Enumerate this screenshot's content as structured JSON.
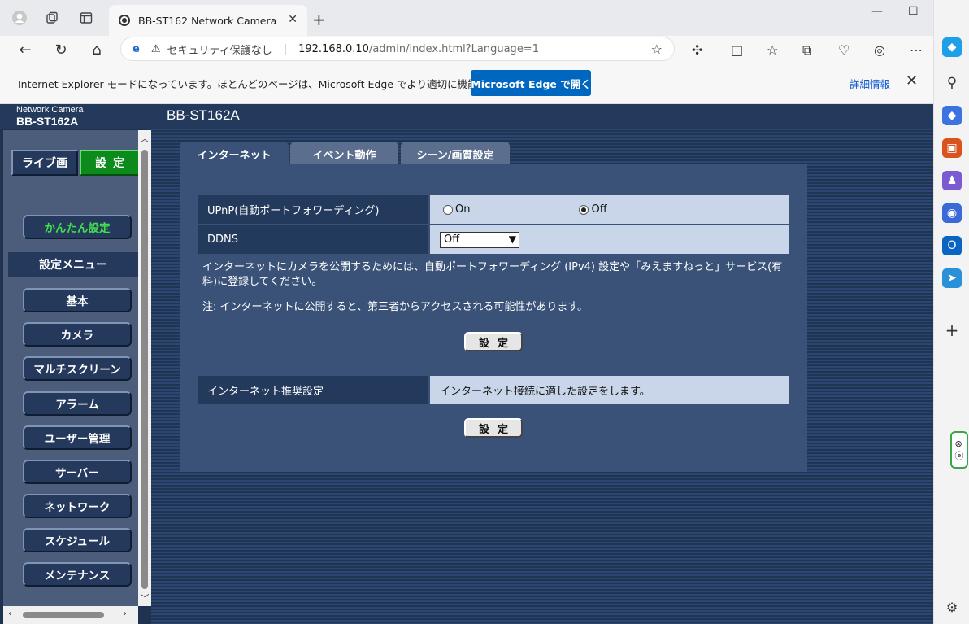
{
  "browser": {
    "tab_title": "BB-ST162 Network Camera",
    "url_security": "セキュリティ保護なし",
    "url_host": "192.168.0.10",
    "url_path": "/admin/index.html?Language=1",
    "new_tab": "+",
    "ie_mode_message": "Internet Explorer モードになっています。ほとんどのページは、Microsoft Edge でより適切に機能します。",
    "open_in_edge_button": "Microsoft Edge で開く",
    "details_link": "詳細情報"
  },
  "camera": {
    "brand_line1": "Network Camera",
    "brand_line2": "BB-ST162A",
    "model_title": "BB-ST162A",
    "mode_live": "ライブ画",
    "mode_setup": "設定",
    "easy_setup": "かんたん設定",
    "menu_heading": "設定メニュー",
    "menu_items": [
      "基本",
      "カメラ",
      "マルチスクリーン",
      "アラーム",
      "ユーザー管理",
      "サーバー",
      "ネットワーク",
      "スケジュール",
      "メンテナンス"
    ],
    "tabs": [
      "インターネット",
      "イベント動作",
      "シーン/画質設定"
    ],
    "upnp_label": "UPnP(自動ポートフォワーディング)",
    "upnp_on": "On",
    "upnp_off": "Off",
    "upnp_selected": "Off",
    "ddns_label": "DDNS",
    "ddns_value": "Off",
    "note1": "インターネットにカメラを公開するためには、自動ポートフォワーディング (IPv4) 設定や「みえますねっと」サービス(有料)に登録してください。",
    "note2": "注: インターネットに公開すると、第三者からアクセスされる可能性があります。",
    "set_button": "設定",
    "recommended_label": "インターネット推奨設定",
    "recommended_value": "インターネット接続に適した設定をします。",
    "set_button2": "設定"
  }
}
